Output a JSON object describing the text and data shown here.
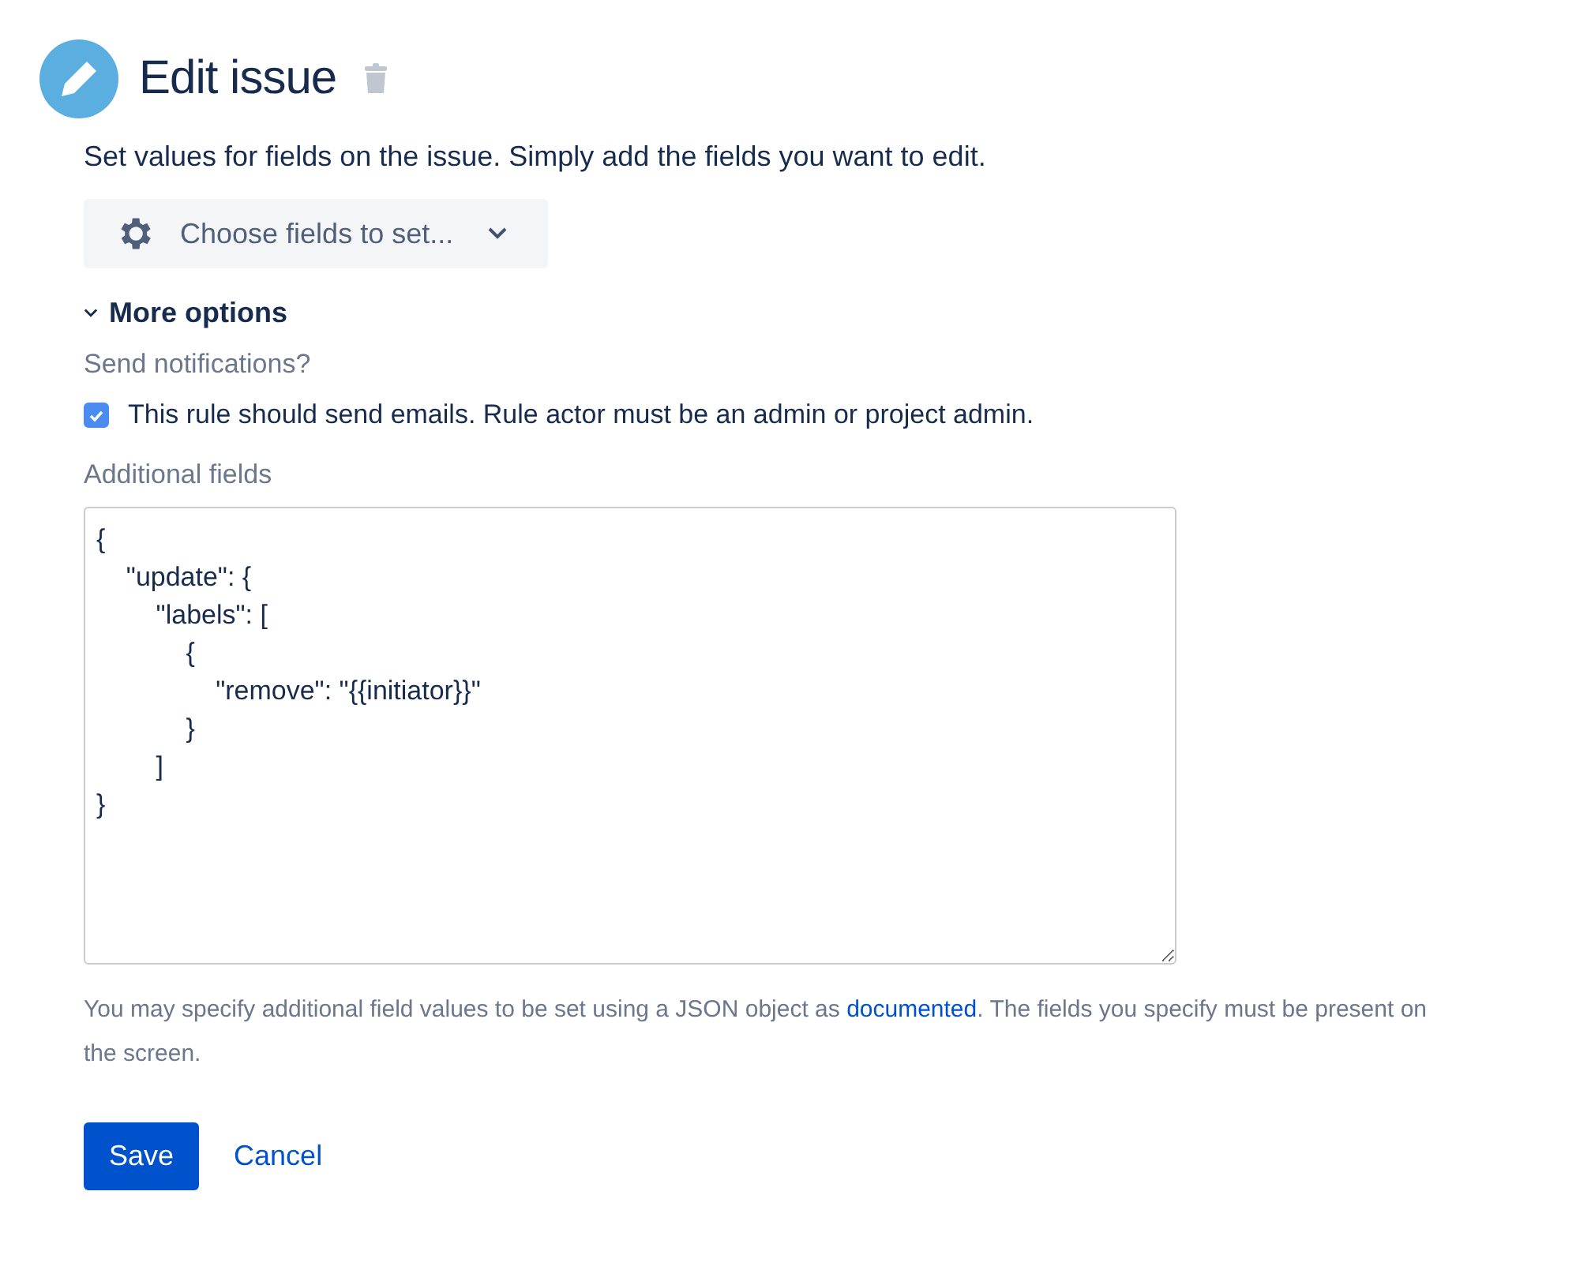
{
  "header": {
    "title": "Edit issue"
  },
  "description": "Set values for fields on the issue. Simply add the fields you want to edit.",
  "field_picker": {
    "label": "Choose fields to set..."
  },
  "more_options": {
    "label": "More options",
    "expanded": true
  },
  "notifications": {
    "label": "Send notifications?",
    "checkbox_label": "This rule should send emails. Rule actor must be an admin or project admin.",
    "checked": true
  },
  "additional_fields": {
    "label": "Additional fields",
    "value": "{\n    \"update\": {\n        \"labels\": [\n            {\n                \"remove\": \"{{initiator}}\"\n            }\n        ]\n}"
  },
  "help": {
    "before": "You may specify additional field values to be set using a JSON object as ",
    "link": "documented",
    "after": ". The fields you specify must be present on the screen."
  },
  "buttons": {
    "save": "Save",
    "cancel": "Cancel"
  }
}
